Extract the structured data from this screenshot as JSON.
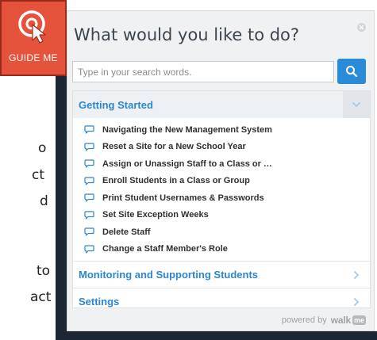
{
  "background": {
    "fragments": [
      "o",
      "ct",
      "d",
      "to",
      "act"
    ]
  },
  "launcher": {
    "label": "GUIDE ME"
  },
  "popup": {
    "title": "What would you like to do?",
    "search": {
      "placeholder": "Type in your search words."
    },
    "sections": [
      {
        "title": "Getting Started",
        "expanded": true,
        "items": [
          "Navigating the New Management System",
          "Reset a Site for a New School Year",
          "Assign or Unassign Staff to a Class or …",
          "Enroll Students in a Class or Group",
          "Print Student Usernames & Passwords",
          "Set Site Exception Weeks",
          "Delete Staff",
          "Change a Staff Member's Role"
        ]
      },
      {
        "title": "Monitoring and Supporting Students",
        "expanded": false
      },
      {
        "title": "Settings",
        "expanded": false
      }
    ],
    "footer": {
      "prefix": "powered by",
      "brand": "walk",
      "badge": "me"
    }
  },
  "colors": {
    "launcher_bg": "#e5533c",
    "accent_blue": "#2a8bd8",
    "section_link": "#2a87d0"
  },
  "icons": {
    "launcher": "cursor-target-icon",
    "search": "search-icon",
    "close": "close-icon",
    "item": "chat-bubble-icon",
    "expanded": "chevron-down-icon",
    "collapsed": "chevron-right-icon"
  }
}
